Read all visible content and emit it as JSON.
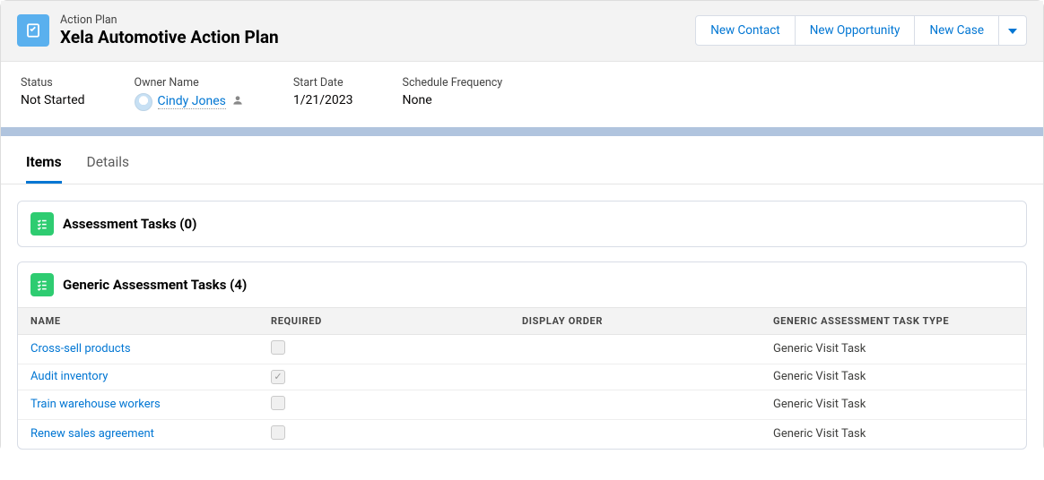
{
  "header": {
    "object_label": "Action Plan",
    "title": "Xela Automotive Action Plan",
    "actions": {
      "new_contact": "New Contact",
      "new_opportunity": "New Opportunity",
      "new_case": "New Case"
    }
  },
  "fields": {
    "status_label": "Status",
    "status_value": "Not Started",
    "owner_label": "Owner Name",
    "owner_value": "Cindy Jones",
    "start_label": "Start Date",
    "start_value": "1/21/2023",
    "schedule_label": "Schedule Frequency",
    "schedule_value": "None"
  },
  "tabs": {
    "items": "Items",
    "details": "Details"
  },
  "panels": {
    "assessment": "Assessment Tasks (0)",
    "generic": "Generic Assessment Tasks (4)"
  },
  "columns": {
    "name": "NAME",
    "required": "REQUIRED",
    "display_order": "DISPLAY ORDER",
    "type": "GENERIC ASSESSMENT TASK TYPE"
  },
  "rows": [
    {
      "name": "Cross-sell products",
      "required": false,
      "type": "Generic Visit Task"
    },
    {
      "name": "Audit inventory",
      "required": true,
      "type": "Generic Visit Task"
    },
    {
      "name": "Train warehouse workers",
      "required": false,
      "type": "Generic Visit Task"
    },
    {
      "name": "Renew sales agreement",
      "required": false,
      "type": "Generic Visit Task"
    }
  ]
}
